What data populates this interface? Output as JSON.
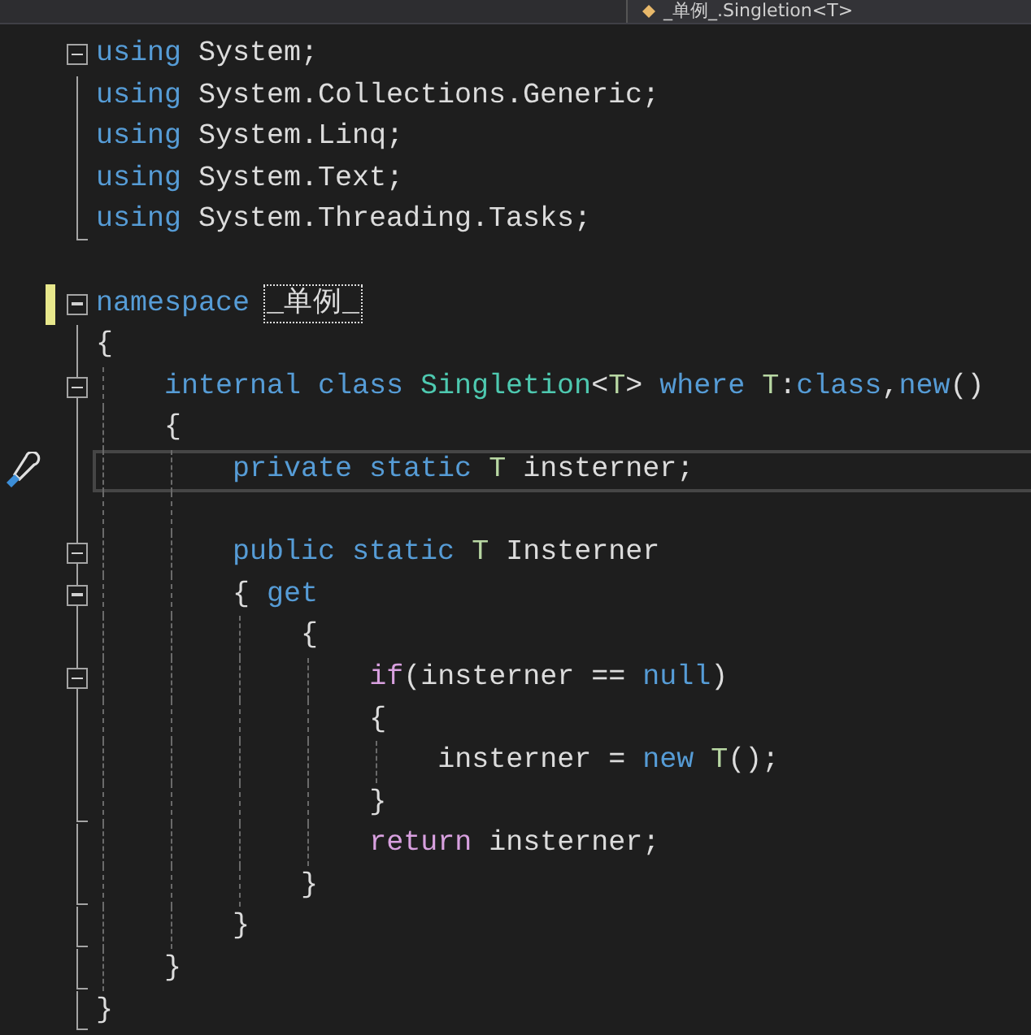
{
  "navigation_bar": {
    "member_dropdown": "_单例_.Singletion<T>"
  },
  "lines": [
    {
      "collapsible": true,
      "outlined": false,
      "block_end": false,
      "changed": false,
      "current": false,
      "action_icon": false,
      "tokens": [
        {
          "kind": "keyword",
          "text": "using"
        },
        {
          "kind": "plain",
          "text": " System;"
        }
      ]
    },
    {
      "collapsible": false,
      "outlined": true,
      "block_end": false,
      "changed": false,
      "current": false,
      "action_icon": false,
      "tokens": [
        {
          "kind": "keyword",
          "text": "using"
        },
        {
          "kind": "plain",
          "text": " System.Collections.Generic;"
        }
      ]
    },
    {
      "collapsible": false,
      "outlined": true,
      "block_end": false,
      "changed": false,
      "current": false,
      "action_icon": false,
      "tokens": [
        {
          "kind": "keyword",
          "text": "using"
        },
        {
          "kind": "plain",
          "text": " System.Linq;"
        }
      ]
    },
    {
      "collapsible": false,
      "outlined": true,
      "block_end": false,
      "changed": false,
      "current": false,
      "action_icon": false,
      "tokens": [
        {
          "kind": "keyword",
          "text": "using"
        },
        {
          "kind": "plain",
          "text": " System.Text;"
        }
      ]
    },
    {
      "collapsible": false,
      "outlined": true,
      "block_end": true,
      "changed": false,
      "current": false,
      "action_icon": false,
      "tokens": [
        {
          "kind": "keyword",
          "text": "using"
        },
        {
          "kind": "plain",
          "text": " System.Threading.Tasks;"
        }
      ]
    },
    {
      "collapsible": false,
      "outlined": false,
      "block_end": false,
      "changed": false,
      "current": false,
      "action_icon": false
    },
    {
      "collapsible": true,
      "outlined": false,
      "block_end": false,
      "changed": true,
      "current": false,
      "action_icon": false,
      "tokens": [
        {
          "kind": "keyword",
          "text": "namespace "
        },
        {
          "kind": "rename",
          "text": "_单例_"
        }
      ]
    },
    {
      "collapsible": false,
      "outlined": true,
      "block_end": false,
      "changed": false,
      "current": false,
      "action_icon": false,
      "tokens": [
        {
          "kind": "brace",
          "text": "{"
        }
      ]
    },
    {
      "collapsible": true,
      "outlined": true,
      "block_end": false,
      "changed": false,
      "current": false,
      "action_icon": false,
      "tokens": [
        {
          "kind": "keyword",
          "text": "    internal "
        },
        {
          "kind": "keyword",
          "text": "class "
        },
        {
          "kind": "type",
          "text": "Singletion"
        },
        {
          "kind": "plain",
          "text": "<"
        },
        {
          "kind": "typeparam",
          "text": "T"
        },
        {
          "kind": "plain",
          "text": "> "
        },
        {
          "kind": "keyword",
          "text": "where "
        },
        {
          "kind": "typeparam",
          "text": "T"
        },
        {
          "kind": "plain",
          "text": ":"
        },
        {
          "kind": "keyword",
          "text": "class"
        },
        {
          "kind": "plain",
          "text": ","
        },
        {
          "kind": "keyword",
          "text": "new"
        },
        {
          "kind": "plain",
          "text": "()"
        }
      ]
    },
    {
      "collapsible": false,
      "outlined": true,
      "block_end": false,
      "changed": false,
      "current": false,
      "action_icon": false,
      "tokens": [
        {
          "kind": "plain",
          "text": "    {"
        }
      ]
    },
    {
      "collapsible": false,
      "outlined": true,
      "block_end": false,
      "changed": false,
      "current": true,
      "action_icon": true,
      "tokens": [
        {
          "kind": "keyword",
          "text": "        private "
        },
        {
          "kind": "keyword",
          "text": "static "
        },
        {
          "kind": "typeparam",
          "text": "T"
        },
        {
          "kind": "plain",
          "text": " insterner;"
        }
      ]
    },
    {
      "collapsible": false,
      "outlined": true,
      "block_end": false,
      "changed": false,
      "current": false,
      "action_icon": false
    },
    {
      "collapsible": true,
      "outlined": true,
      "block_end": false,
      "changed": false,
      "current": false,
      "action_icon": false,
      "tokens": [
        {
          "kind": "keyword",
          "text": "        public "
        },
        {
          "kind": "keyword",
          "text": "static "
        },
        {
          "kind": "typeparam",
          "text": "T"
        },
        {
          "kind": "plain",
          "text": " Insterner"
        }
      ]
    },
    {
      "collapsible": true,
      "outlined": true,
      "block_end": false,
      "changed": false,
      "current": false,
      "action_icon": false,
      "tokens": [
        {
          "kind": "plain",
          "text": "        { "
        },
        {
          "kind": "keyword",
          "text": "get"
        }
      ]
    },
    {
      "collapsible": false,
      "outlined": true,
      "block_end": false,
      "changed": false,
      "current": false,
      "action_icon": false,
      "tokens": [
        {
          "kind": "plain",
          "text": "            {"
        }
      ]
    },
    {
      "collapsible": true,
      "outlined": true,
      "block_end": false,
      "changed": false,
      "current": false,
      "action_icon": false,
      "tokens": [
        {
          "kind": "control",
          "text": "                if"
        },
        {
          "kind": "plain",
          "text": "(insterner == "
        },
        {
          "kind": "keyword",
          "text": "null"
        },
        {
          "kind": "plain",
          "text": ")"
        }
      ]
    },
    {
      "collapsible": false,
      "outlined": true,
      "block_end": false,
      "changed": false,
      "current": false,
      "action_icon": false,
      "tokens": [
        {
          "kind": "plain",
          "text": "                {"
        }
      ]
    },
    {
      "collapsible": false,
      "outlined": true,
      "block_end": false,
      "changed": false,
      "current": false,
      "action_icon": false,
      "tokens": [
        {
          "kind": "plain",
          "text": "                    insterner = "
        },
        {
          "kind": "keyword",
          "text": "new "
        },
        {
          "kind": "typeparam",
          "text": "T"
        },
        {
          "kind": "plain",
          "text": "();"
        }
      ]
    },
    {
      "collapsible": false,
      "outlined": true,
      "block_end": true,
      "changed": false,
      "current": false,
      "action_icon": false,
      "tokens": [
        {
          "kind": "plain",
          "text": "                }"
        }
      ]
    },
    {
      "collapsible": false,
      "outlined": true,
      "block_end": false,
      "changed": false,
      "current": false,
      "action_icon": false,
      "tokens": [
        {
          "kind": "control",
          "text": "                return"
        },
        {
          "kind": "plain",
          "text": " insterner;"
        }
      ]
    },
    {
      "collapsible": false,
      "outlined": true,
      "block_end": true,
      "changed": false,
      "current": false,
      "action_icon": false,
      "tokens": [
        {
          "kind": "plain",
          "text": "            }"
        }
      ]
    },
    {
      "collapsible": false,
      "outlined": true,
      "block_end": true,
      "changed": false,
      "current": false,
      "action_icon": false,
      "tokens": [
        {
          "kind": "plain",
          "text": "        }"
        }
      ]
    },
    {
      "collapsible": false,
      "outlined": true,
      "block_end": true,
      "changed": false,
      "current": false,
      "action_icon": false,
      "tokens": [
        {
          "kind": "plain",
          "text": "    }"
        }
      ]
    },
    {
      "collapsible": false,
      "outlined": true,
      "block_end": true,
      "changed": false,
      "current": false,
      "action_icon": false,
      "tokens": [
        {
          "kind": "brace",
          "text": "}"
        }
      ]
    }
  ]
}
